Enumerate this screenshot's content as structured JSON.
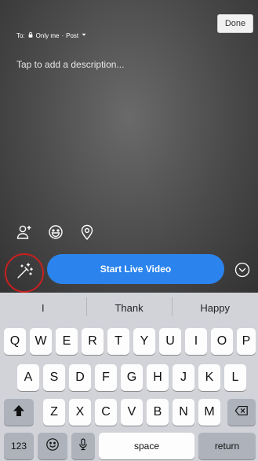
{
  "header": {
    "done_label": "Done",
    "to_label": "To:",
    "audience": "Only me",
    "post_type": "Post",
    "description_placeholder": "Tap to add a description..."
  },
  "tools": {
    "icons": [
      "tag-people-icon",
      "feeling-icon",
      "location-icon"
    ]
  },
  "bottom_bar": {
    "effects_icon": "magic-wand-icon",
    "start_live_label": "Start Live Video",
    "more_icon": "chevron-down-circle-icon",
    "accent_color": "#2b84ee",
    "highlight_color": "#c8201f"
  },
  "keyboard": {
    "suggestions": [
      "I",
      "Thank",
      "Happy"
    ],
    "row1": [
      "Q",
      "W",
      "E",
      "R",
      "T",
      "Y",
      "U",
      "I",
      "O",
      "P"
    ],
    "row2": [
      "A",
      "S",
      "D",
      "F",
      "G",
      "H",
      "J",
      "K",
      "L"
    ],
    "row3": [
      "Z",
      "X",
      "C",
      "V",
      "B",
      "N",
      "M"
    ],
    "numbers_label": "123",
    "space_label": "space",
    "return_label": "return"
  }
}
